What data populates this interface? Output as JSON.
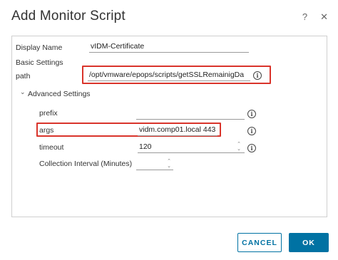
{
  "dialog": {
    "title": "Add Monitor Script",
    "help_symbol": "?",
    "close_symbol": "✕"
  },
  "form": {
    "display_name_label": "Display Name",
    "display_name_value": "vIDM-Certificate",
    "basic_settings_label": "Basic Settings",
    "path_label": "path",
    "path_value": "/opt/vmware/epops/scripts/getSSLRemainigDa",
    "advanced_settings_label": "Advanced Settings",
    "prefix_label": "prefix",
    "prefix_value": "",
    "args_label": "args",
    "args_value": "vidm.comp01.local 443",
    "timeout_label": "timeout",
    "timeout_value": "120",
    "interval_label": "Collection Interval (Minutes)",
    "interval_value": ""
  },
  "buttons": {
    "cancel_label": "CANCEL",
    "ok_label": "OK"
  },
  "icons": {
    "info": "info-icon",
    "chevron": "chevron-down-icon",
    "spinner": "up-down-spinner-icon"
  },
  "colors": {
    "highlight": "#d9342b",
    "primary": "#0072a3"
  }
}
